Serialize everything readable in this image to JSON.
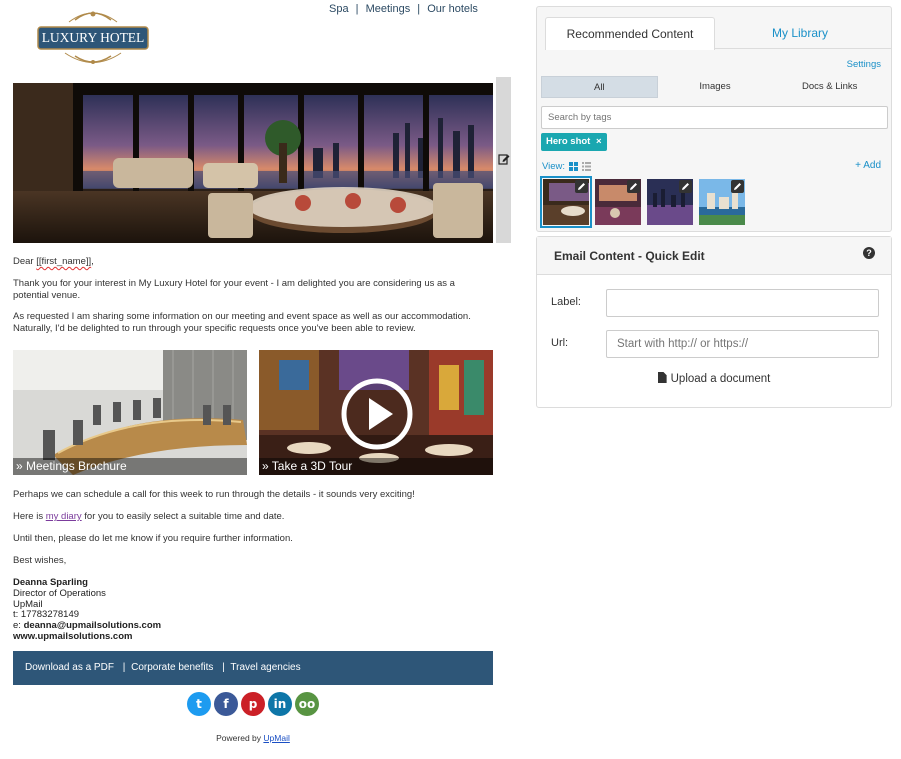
{
  "email": {
    "logo_text": "LUXURY HOTEL",
    "nav": [
      "Spa",
      "Meetings",
      "Our hotels"
    ],
    "nav_separator": "|",
    "greeting_prefix": "Dear ",
    "greeting_merge": "[[first_name]]",
    "greeting_suffix": ",",
    "para1": "Thank you for your interest in My Luxury Hotel for your event - I am delighted you are considering us as a potential venue.",
    "para2": "As requested I am sharing some information on our meeting and event space as well as our accommodation. Naturally, I'd be delighted to run through your specific requests once you've been able to review.",
    "tile1_caption": "» Meetings Brochure",
    "tile2_caption": "» Take a 3D Tour",
    "para3": "Perhaps we can schedule a call for this week to run through the details - it sounds very exciting!",
    "para4_prefix": "Here is ",
    "para4_link": "my diary",
    "para4_suffix": " for you to easily select a suitable time and date.",
    "para5": "Until then, please do let me know if you require further information.",
    "closing": "Best wishes,",
    "signature": {
      "name": "Deanna Sparling",
      "title": "Director of Operations",
      "company": "UpMail",
      "phone": "t: 17783278149",
      "email_prefix": "e: ",
      "email": "deanna@upmailsolutions.com",
      "website": "www.upmailsolutions.com"
    },
    "footer_links": [
      "Download as a PDF",
      "Corporate benefits",
      "Travel agencies"
    ],
    "footer_separator": "|",
    "social": [
      {
        "name": "twitter-icon",
        "glyph": "t",
        "color": "#1d9bf0"
      },
      {
        "name": "facebook-icon",
        "glyph": "f",
        "color": "#3b5998"
      },
      {
        "name": "pinterest-icon",
        "glyph": "p",
        "color": "#cb2027"
      },
      {
        "name": "linkedin-icon",
        "glyph": "in",
        "color": "#0e76a8"
      },
      {
        "name": "tripadvisor-icon",
        "glyph": "oo",
        "color": "#589442"
      }
    ],
    "powered_prefix": "Powered by ",
    "powered_link": "UpMail"
  },
  "content_panel": {
    "tabs": [
      "Recommended Content",
      "My Library"
    ],
    "settings_label": "Settings",
    "filters": [
      "All",
      "Images",
      "Docs & Links"
    ],
    "active_filter": "All",
    "search_placeholder": "Search by tags",
    "tag_chip": "Hero shot",
    "tag_chip_remove": "×",
    "view_label": "View:",
    "add_label": "+ Add",
    "accent_color": "#1a90c8",
    "chip_color": "#1aa7b0"
  },
  "quick_edit": {
    "title": "Email Content - Quick Edit",
    "help_glyph": "?",
    "label_field_label": "Label:",
    "label_value": "",
    "url_field_label": "Url:",
    "url_placeholder": "Start with http:// or https://",
    "upload_label": "Upload a document"
  },
  "colors": {
    "footer_bar": "#2e5678",
    "nav_text": "#2c4a63"
  }
}
